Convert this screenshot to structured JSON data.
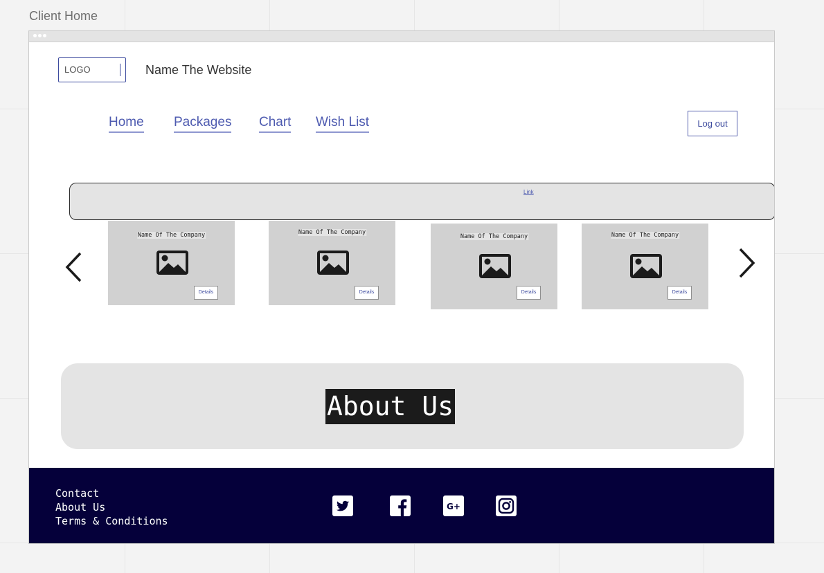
{
  "board": {
    "title": "Client Home"
  },
  "header": {
    "logo_text": "LOGO",
    "site_name": "Name The Website"
  },
  "nav": {
    "items": [
      {
        "label": "Home"
      },
      {
        "label": "Packages"
      },
      {
        "label": "Chart"
      },
      {
        "label": "Wish List"
      }
    ],
    "logout_label": "Log out"
  },
  "banner": {
    "link_label": "Link"
  },
  "carousel": {
    "cards": [
      {
        "name": "Name Of The Company",
        "button": "Details",
        "image_icon": "image-icon"
      },
      {
        "name": "Name Of The Company",
        "button": "Details",
        "image_icon": "image-icon"
      },
      {
        "name": "Name Of The Company",
        "button": "Details",
        "image_icon": "image-icon"
      },
      {
        "name": "Name Of The Company",
        "button": "Details",
        "image_icon": "image-icon"
      }
    ],
    "prev_icon": "chevron-left-icon",
    "next_icon": "chevron-right-icon"
  },
  "about": {
    "title": "About Us"
  },
  "footer": {
    "links": [
      "Contact",
      "About Us",
      "Terms & Conditions"
    ],
    "social": [
      "twitter-icon",
      "facebook-icon",
      "google-plus-icon",
      "instagram-icon"
    ]
  },
  "colors": {
    "accent": "#4e5bb0",
    "footer_bg": "#05003a",
    "card_bg": "#d1d1d1",
    "panel_bg": "#e4e4e4"
  }
}
